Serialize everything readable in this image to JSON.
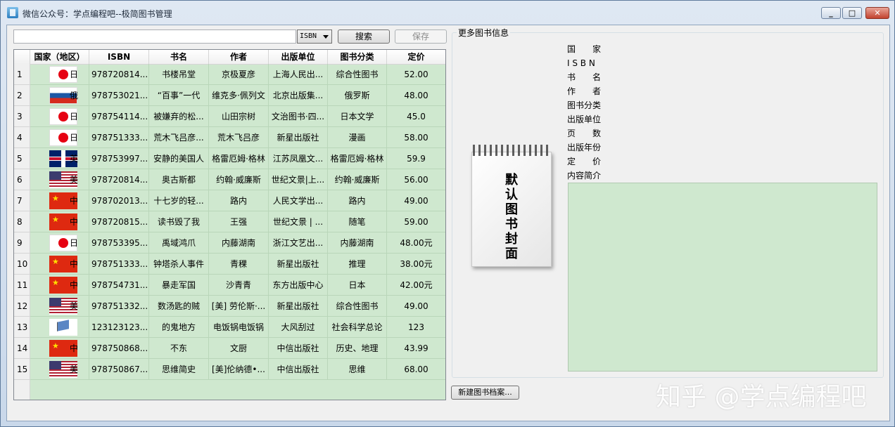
{
  "window": {
    "title": "微信公众号：学点编程吧--极简图书管理"
  },
  "toolbar": {
    "search_value": "",
    "field_selected": "ISBN",
    "search_label": "搜索",
    "save_label": "保存",
    "new_record_label": "新建图书档案..."
  },
  "table": {
    "headers": [
      "国家（地区）",
      "ISBN",
      "书名",
      "作者",
      "出版单位",
      "图书分类",
      "定价"
    ],
    "rows": [
      {
        "no": "1",
        "flag": "jp",
        "country": "日",
        "isbn": "978720814...",
        "title": "书楼吊堂",
        "author": "京极夏彦",
        "publisher": "上海人民出...",
        "category": "综合性图书",
        "price": "52.00"
      },
      {
        "no": "2",
        "flag": "ru",
        "country": "俄",
        "isbn": "978753021...",
        "title": "“百事”一代",
        "author": "维克多·佩列文",
        "publisher": "北京出版集...",
        "category": "俄罗斯",
        "price": "48.00"
      },
      {
        "no": "3",
        "flag": "jp",
        "country": "日",
        "isbn": "978754114...",
        "title": "被嫌弃的松...",
        "author": "山田宗树",
        "publisher": "文治图书·四...",
        "category": "日本文学",
        "price": "45.0"
      },
      {
        "no": "4",
        "flag": "jp",
        "country": "日",
        "isbn": "978751333...",
        "title": "荒木飞吕彦...",
        "author": "荒木飞吕彦",
        "publisher": "新星出版社",
        "category": "漫画",
        "price": "58.00"
      },
      {
        "no": "5",
        "flag": "gb",
        "country": "英",
        "isbn": "978753997...",
        "title": "安静的美国人",
        "author": "格雷厄姆·格林",
        "publisher": "江苏凤凰文...",
        "category": "格雷厄姆·格林",
        "price": "59.9"
      },
      {
        "no": "6",
        "flag": "us",
        "country": "美",
        "isbn": "978720814...",
        "title": "奥古斯都",
        "author": "约翰·威廉斯",
        "publisher": "世纪文景|上...",
        "category": "约翰·威廉斯",
        "price": "56.00"
      },
      {
        "no": "7",
        "flag": "cn",
        "country": "中",
        "isbn": "978702013...",
        "title": "十七岁的轻...",
        "author": "路内",
        "publisher": "人民文学出...",
        "category": "路内",
        "price": "49.00"
      },
      {
        "no": "8",
        "flag": "cn",
        "country": "中",
        "isbn": "978720815...",
        "title": "读书毁了我",
        "author": "王强",
        "publisher": "世纪文景 | ...",
        "category": "随笔",
        "price": "59.00"
      },
      {
        "no": "9",
        "flag": "jp",
        "country": "日",
        "isbn": "978753395...",
        "title": "禹域鸿爪",
        "author": "内藤湖南",
        "publisher": "浙江文艺出...",
        "category": "内藤湖南",
        "price": "48.00元"
      },
      {
        "no": "10",
        "flag": "cn",
        "country": "中",
        "isbn": "978751333...",
        "title": "钟塔杀人事件",
        "author": "青稞",
        "publisher": "新星出版社",
        "category": "推理",
        "price": "38.00元"
      },
      {
        "no": "11",
        "flag": "cn",
        "country": "中",
        "isbn": "978754731...",
        "title": "暴走军国",
        "author": "沙青青",
        "publisher": "东方出版中心",
        "category": "日本",
        "price": "42.00元"
      },
      {
        "no": "12",
        "flag": "us",
        "country": "美",
        "isbn": "978751332...",
        "title": "数汤匙的贼",
        "author": "[美] 劳伦斯·...",
        "publisher": "新星出版社",
        "category": "综合性图书",
        "price": "49.00"
      },
      {
        "no": "13",
        "flag": "un",
        "country": "",
        "isbn": "123123123...",
        "title": "的鬼地方",
        "author": "电饭锅电饭锅",
        "publisher": "大风刮过",
        "category": "社会科学总论",
        "price": "123"
      },
      {
        "no": "14",
        "flag": "cn",
        "country": "中",
        "isbn": "978750868...",
        "title": "不东",
        "author": "文厨",
        "publisher": "中信出版社",
        "category": "历史、地理",
        "price": "43.99"
      },
      {
        "no": "15",
        "flag": "us",
        "country": "美",
        "isbn": "978750867...",
        "title": "思维简史",
        "author": "[美]伦纳德•...",
        "publisher": "中信出版社",
        "category": "思维",
        "price": "68.00"
      }
    ]
  },
  "details": {
    "group_title": "更多图书信息",
    "cover_text": "默认图书封面",
    "labels": [
      "国　　家",
      "I S B N",
      "书　　名",
      "作　　者",
      "图书分类",
      "出版单位",
      "页　　数",
      "出版年份",
      "定　　价",
      "内容简介"
    ]
  },
  "watermark": "知乎 @学点编程吧"
}
